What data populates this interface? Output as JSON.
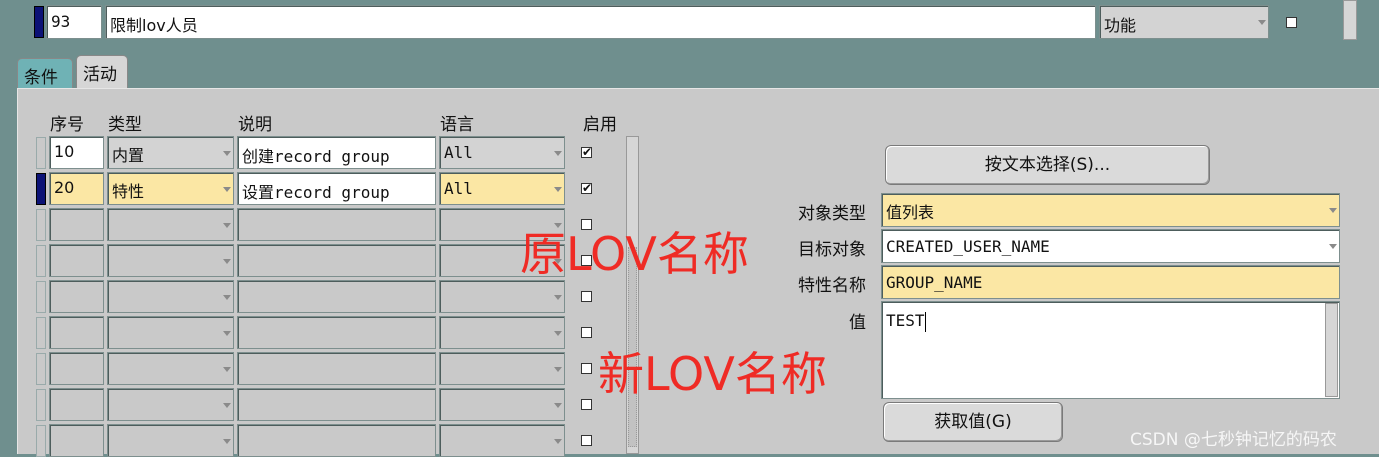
{
  "top_row": {
    "seq": "93",
    "description": "限制lov人员",
    "type": "功能",
    "enabled": false
  },
  "tabs": [
    {
      "label": "条件"
    },
    {
      "label": "活动"
    }
  ],
  "columns": {
    "seq": "序号",
    "type": "类型",
    "description": "说明",
    "language": "语言",
    "enabled": "启用"
  },
  "rows": [
    {
      "seq": "10",
      "type": "内置",
      "description": "创建record group",
      "language": "All",
      "enabled": true
    },
    {
      "seq": "20",
      "type": "特性",
      "description": "设置record group",
      "language": "All",
      "enabled": true
    }
  ],
  "empty_row_count": 7,
  "right_panel": {
    "select_text_button": "按文本选择(S)...",
    "object_type_label": "对象类型",
    "object_type_value": "值列表",
    "target_object_label": "目标对象",
    "target_object_value": "CREATED_USER_NAME",
    "property_name_label": "特性名称",
    "property_name_value": "GROUP_NAME",
    "value_label": "值",
    "value_value": "TEST",
    "get_value_button": "获取值(G)"
  },
  "annotations": {
    "original_lov": "原LOV名称",
    "new_lov": "新LOV名称"
  },
  "watermark": "CSDN @七秒钟记忆的码农",
  "colors": {
    "background": "#6f8f8e",
    "panel": "#c9c9c9",
    "required_field": "#fbe7a4",
    "annotation": "#ef2b25",
    "record_marker": "#0c1276"
  }
}
